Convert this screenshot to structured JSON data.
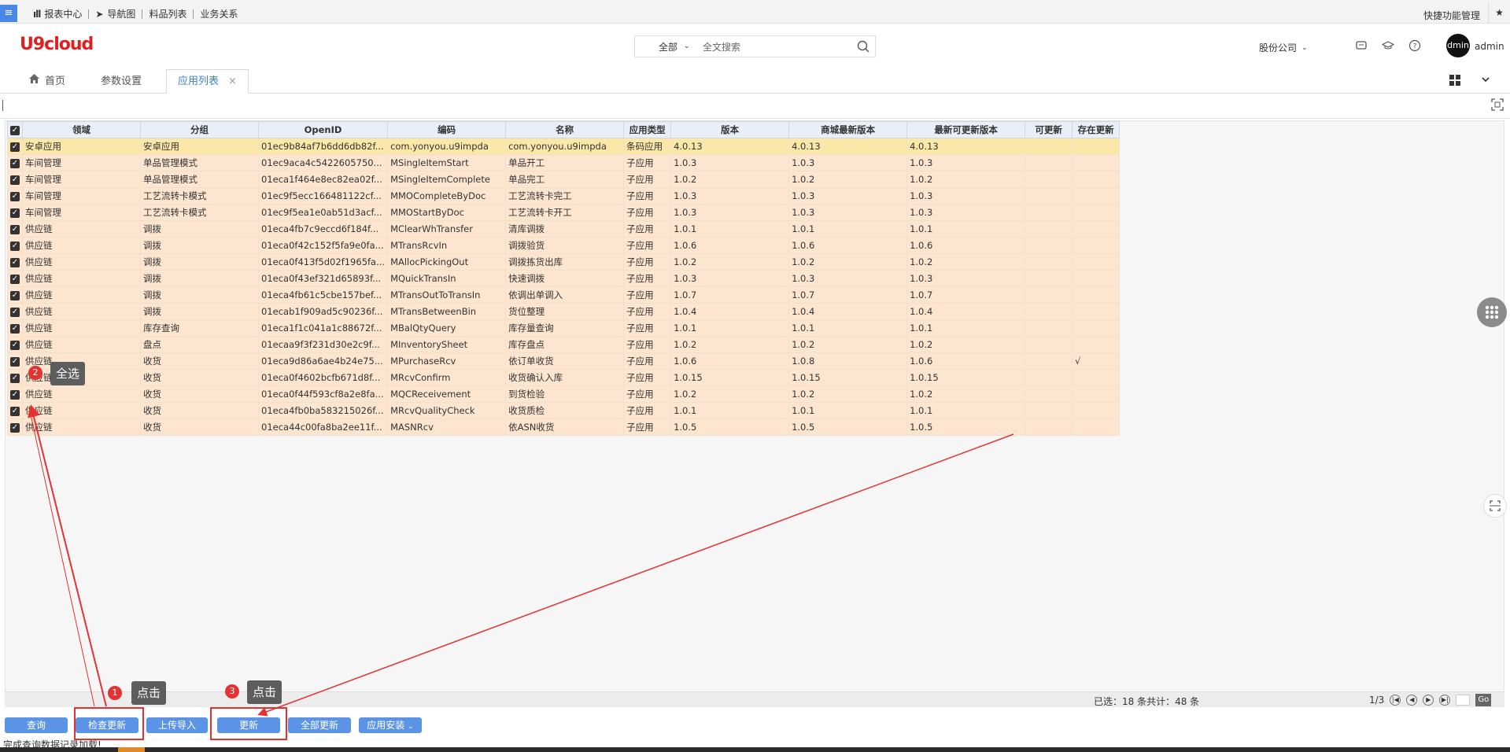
{
  "topbar": {
    "nav": [
      "报表中心",
      "导航图",
      "料品列表",
      "业务关系"
    ],
    "shortcut": "快捷功能管理"
  },
  "header": {
    "logo": "U9cloud",
    "search_scope": "全部",
    "search_placeholder": "全文搜索",
    "company": "股份公司",
    "avatar_text": "dmin",
    "username": "admin"
  },
  "tabs": [
    {
      "label": "首页"
    },
    {
      "label": "参数设置"
    },
    {
      "label": "应用列表",
      "close": "×"
    }
  ],
  "grid": {
    "columns": [
      "领域",
      "分组",
      "OpenID",
      "编码",
      "名称",
      "应用类型",
      "版本",
      "商城最新版本",
      "最新可更新版本",
      "可更新",
      "存在更新"
    ],
    "rows": [
      [
        "安卓应用",
        "安卓应用",
        "01ec9b84af7b6dd6db82f...",
        "com.yonyou.u9impda",
        "com.yonyou.u9impda",
        "条码应用",
        "4.0.13",
        "4.0.13",
        "4.0.13",
        "",
        ""
      ],
      [
        "车间管理",
        "单品管理模式",
        "01ec9aca4c5422605750...",
        "MSingleItemStart",
        "单品开工",
        "子应用",
        "1.0.3",
        "1.0.3",
        "1.0.3",
        "",
        ""
      ],
      [
        "车间管理",
        "单品管理模式",
        "01eca1f464e8ec82ea02f...",
        "MSingleItemComplete",
        "单品完工",
        "子应用",
        "1.0.2",
        "1.0.2",
        "1.0.2",
        "",
        ""
      ],
      [
        "车间管理",
        "工艺流转卡模式",
        "01ec9f5ecc166481122cf...",
        "MMOCompleteByDoc",
        "工艺流转卡完工",
        "子应用",
        "1.0.3",
        "1.0.3",
        "1.0.3",
        "",
        ""
      ],
      [
        "车间管理",
        "工艺流转卡模式",
        "01ec9f5ea1e0ab51d3acf...",
        "MMOStartByDoc",
        "工艺流转卡开工",
        "子应用",
        "1.0.3",
        "1.0.3",
        "1.0.3",
        "",
        ""
      ],
      [
        "供应链",
        "调拨",
        "01eca4fb7c9eccd6f184f...",
        "MClearWhTransfer",
        "清库调拨",
        "子应用",
        "1.0.1",
        "1.0.1",
        "1.0.1",
        "",
        ""
      ],
      [
        "供应链",
        "调拨",
        "01eca0f42c152f5fa9e0fa...",
        "MTransRcvIn",
        "调拨验货",
        "子应用",
        "1.0.6",
        "1.0.6",
        "1.0.6",
        "",
        ""
      ],
      [
        "供应链",
        "调拨",
        "01eca0f413f5d02f1965fa...",
        "MAllocPickingOut",
        "调拨拣货出库",
        "子应用",
        "1.0.2",
        "1.0.2",
        "1.0.2",
        "",
        ""
      ],
      [
        "供应链",
        "调拨",
        "01eca0f43ef321d65893f...",
        "MQuickTransIn",
        "快速调拨",
        "子应用",
        "1.0.3",
        "1.0.3",
        "1.0.3",
        "",
        ""
      ],
      [
        "供应链",
        "调拨",
        "01eca4fb61c5cbe157bef...",
        "MTransOutToTransIn",
        "依调出单调入",
        "子应用",
        "1.0.7",
        "1.0.7",
        "1.0.7",
        "",
        ""
      ],
      [
        "供应链",
        "调拨",
        "01ecab1f909ad5c90236f...",
        "MTransBetweenBin",
        "货位整理",
        "子应用",
        "1.0.4",
        "1.0.4",
        "1.0.4",
        "",
        ""
      ],
      [
        "供应链",
        "库存查询",
        "01eca1f1c041a1c88672f...",
        "MBalQtyQuery",
        "库存量查询",
        "子应用",
        "1.0.1",
        "1.0.1",
        "1.0.1",
        "",
        ""
      ],
      [
        "供应链",
        "盘点",
        "01ecaa9f3f231d30e2c9f...",
        "MInventorySheet",
        "库存盘点",
        "子应用",
        "1.0.2",
        "1.0.2",
        "1.0.2",
        "",
        ""
      ],
      [
        "供应链",
        "收货",
        "01eca9d86a6ae4b24e75...",
        "MPurchaseRcv",
        "依订单收货",
        "子应用",
        "1.0.6",
        "1.0.8",
        "1.0.6",
        "",
        "√"
      ],
      [
        "供应链",
        "收货",
        "01eca0f4602bcfb671d8f...",
        "MRcvConfirm",
        "收货确认入库",
        "子应用",
        "1.0.15",
        "1.0.15",
        "1.0.15",
        "",
        ""
      ],
      [
        "供应链",
        "收货",
        "01eca0f44f593cf8a2e8fa...",
        "MQCReceivement",
        "到货检验",
        "子应用",
        "1.0.2",
        "1.0.2",
        "1.0.2",
        "",
        ""
      ],
      [
        "供应链",
        "收货",
        "01eca4fb0ba583215026f...",
        "MRcvQualityCheck",
        "收货质检",
        "子应用",
        "1.0.1",
        "1.0.1",
        "1.0.1",
        "",
        ""
      ],
      [
        "供应链",
        "收货",
        "01eca44c00fa8ba2ee11f...",
        "MASNRcv",
        "依ASN收货",
        "子应用",
        "1.0.5",
        "1.0.5",
        "1.0.5",
        "",
        ""
      ]
    ]
  },
  "footer": {
    "summary": "已选：18 条共计：48 条",
    "page": "1/3",
    "go": "Go"
  },
  "buttons": {
    "query": "查询",
    "check_update": "检查更新",
    "upload_import": "上传导入",
    "update": "更新",
    "update_all": "全部更新",
    "app_install": "应用安装"
  },
  "status": "完成查询数据记录加载!",
  "annotations": {
    "b1": "1",
    "t1": "点击",
    "b2": "2",
    "t2": "全选",
    "b3": "3",
    "t3": "点击"
  },
  "colors": {
    "accent": "#5b94e6",
    "logo": "#e02020",
    "row_bg": "#fde5cf",
    "row_selected": "#fbe8a8",
    "annotation_red": "#e43232"
  }
}
